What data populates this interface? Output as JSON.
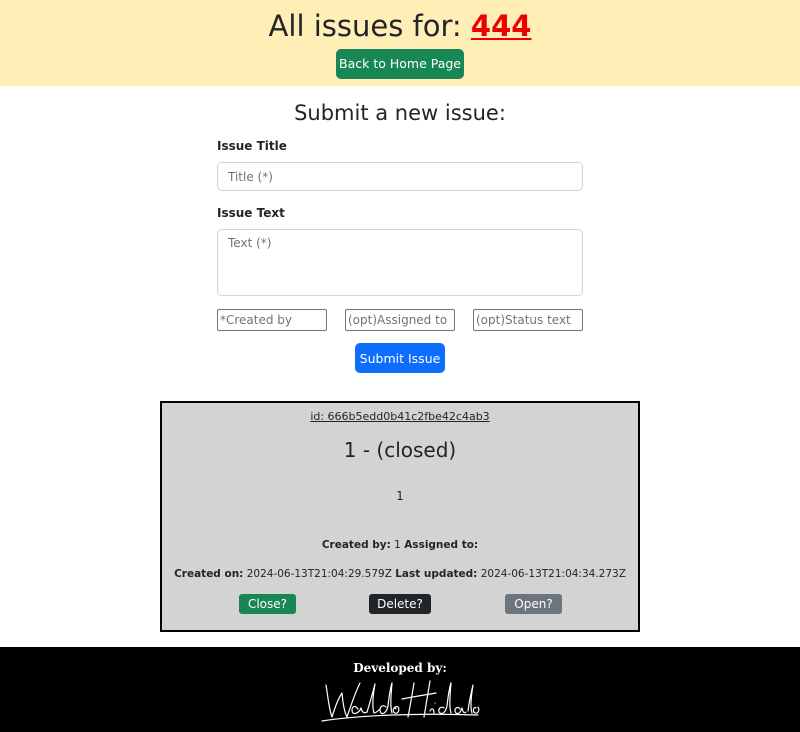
{
  "header": {
    "title_prefix": "All issues for: ",
    "project_name": "444",
    "home_button": "Back to Home Page"
  },
  "form": {
    "heading": "Submit a new issue:",
    "title_label": "Issue Title",
    "title_placeholder": "Title (*)",
    "text_label": "Issue Text",
    "text_placeholder": "Text (*)",
    "created_by_placeholder": "*Created by",
    "assigned_to_placeholder": "(opt)Assigned to",
    "status_placeholder": "(opt)Status text",
    "submit_button": "Submit Issue"
  },
  "issue": {
    "id": "id: 666b5edd0b41c2fbe42c4ab3",
    "heading": "1 - (closed)",
    "text": "1",
    "created_by_label": "Created by:",
    "created_by": "1",
    "assigned_to_label": "Assigned to:",
    "assigned_to": "",
    "created_on_label": "Created on:",
    "created_on": "2024-06-13T21:04:29.579Z",
    "updated_label": "Last updated:",
    "updated_on": "2024-06-13T21:04:34.273Z",
    "close_button": "Close?",
    "delete_button": "Delete?",
    "open_button": "Open?"
  },
  "footer": {
    "label": "Developed by:",
    "signature": "Waldo Hidalgo"
  },
  "colors": {
    "header_bg": "#ffeeb5",
    "project_link": "#ee0000",
    "success": "#198754",
    "primary": "#0d6efd",
    "dark": "#212529",
    "secondary": "#6c757d",
    "card_bg": "#d3d3d3"
  }
}
